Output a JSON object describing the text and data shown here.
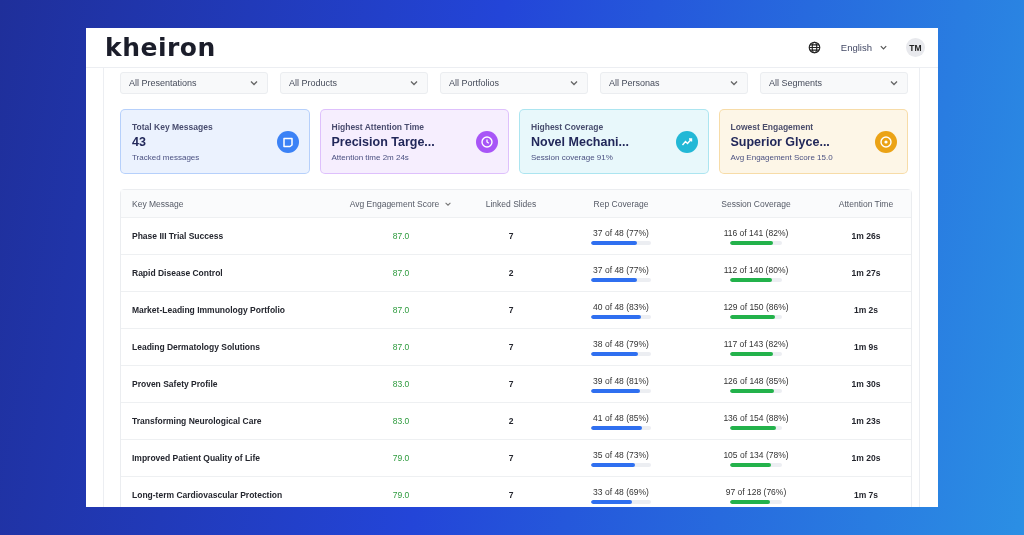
{
  "header": {
    "logo": "kheiron",
    "language": "English",
    "avatar": "TM"
  },
  "filters": [
    {
      "label": "All Presentations"
    },
    {
      "label": "All Products"
    },
    {
      "label": "All Portfolios"
    },
    {
      "label": "All Personas"
    },
    {
      "label": "All Segments"
    }
  ],
  "cards": [
    {
      "title": "Total Key Messages",
      "value": "43",
      "caption": "Tracked messages",
      "kind": "message",
      "color": "#3b82f6"
    },
    {
      "title": "Highest Attention Time",
      "value": "Precision Targe...",
      "caption": "Attention time 2m 24s",
      "kind": "clock",
      "color": "#a855f7"
    },
    {
      "title": "Highest Coverage",
      "value": "Novel Mechani...",
      "caption": "Session coverage 91%",
      "kind": "trend",
      "color": "#22b8d6"
    },
    {
      "title": "Lowest Engagement",
      "value": "Superior Glyce...",
      "caption": "Avg Engagement Score 15.0",
      "kind": "target",
      "color": "#eba316"
    }
  ],
  "table": {
    "columns": [
      {
        "label": "Key Message",
        "sorted": false
      },
      {
        "label": "Avg Engagement Score",
        "sorted": true
      },
      {
        "label": "Linked Slides",
        "sorted": false
      },
      {
        "label": "Rep Coverage",
        "sorted": false
      },
      {
        "label": "Session Coverage",
        "sorted": false
      },
      {
        "label": "Attention Time",
        "sorted": false
      }
    ],
    "rows": [
      {
        "message": "Phase III Trial Success",
        "score": "87.0",
        "slides": "7",
        "rep": {
          "text": "37 of 48 (77%)",
          "level": 0.77
        },
        "session": {
          "text": "116 of 141 (82%)",
          "level": 0.82
        },
        "time": "1m 26s"
      },
      {
        "message": "Rapid Disease Control",
        "score": "87.0",
        "slides": "2",
        "rep": {
          "text": "37 of 48 (77%)",
          "level": 0.77
        },
        "session": {
          "text": "112 of 140 (80%)",
          "level": 0.8
        },
        "time": "1m 27s"
      },
      {
        "message": "Market-Leading Immunology Portfolio",
        "score": "87.0",
        "slides": "7",
        "rep": {
          "text": "40 of 48 (83%)",
          "level": 0.83
        },
        "session": {
          "text": "129 of 150 (86%)",
          "level": 0.86
        },
        "time": "1m 2s"
      },
      {
        "message": "Leading Dermatology Solutions",
        "score": "87.0",
        "slides": "7",
        "rep": {
          "text": "38 of 48 (79%)",
          "level": 0.79
        },
        "session": {
          "text": "117 of 143 (82%)",
          "level": 0.82
        },
        "time": "1m 9s"
      },
      {
        "message": "Proven Safety Profile",
        "score": "83.0",
        "slides": "7",
        "rep": {
          "text": "39 of 48 (81%)",
          "level": 0.81
        },
        "session": {
          "text": "126 of 148 (85%)",
          "level": 0.85
        },
        "time": "1m 30s"
      },
      {
        "message": "Transforming Neurological Care",
        "score": "83.0",
        "slides": "2",
        "rep": {
          "text": "41 of 48 (85%)",
          "level": 0.85
        },
        "session": {
          "text": "136 of 154 (88%)",
          "level": 0.88
        },
        "time": "1m 23s"
      },
      {
        "message": "Improved Patient Quality of Life",
        "score": "79.0",
        "slides": "7",
        "rep": {
          "text": "35 of 48 (73%)",
          "level": 0.73
        },
        "session": {
          "text": "105 of 134 (78%)",
          "level": 0.78
        },
        "time": "1m 20s"
      },
      {
        "message": "Long-term Cardiovascular Protection",
        "score": "79.0",
        "slides": "7",
        "rep": {
          "text": "33 of 48 (69%)",
          "level": 0.69
        },
        "session": {
          "text": "97 of 128 (76%)",
          "level": 0.76
        },
        "time": "1m 7s"
      }
    ]
  }
}
